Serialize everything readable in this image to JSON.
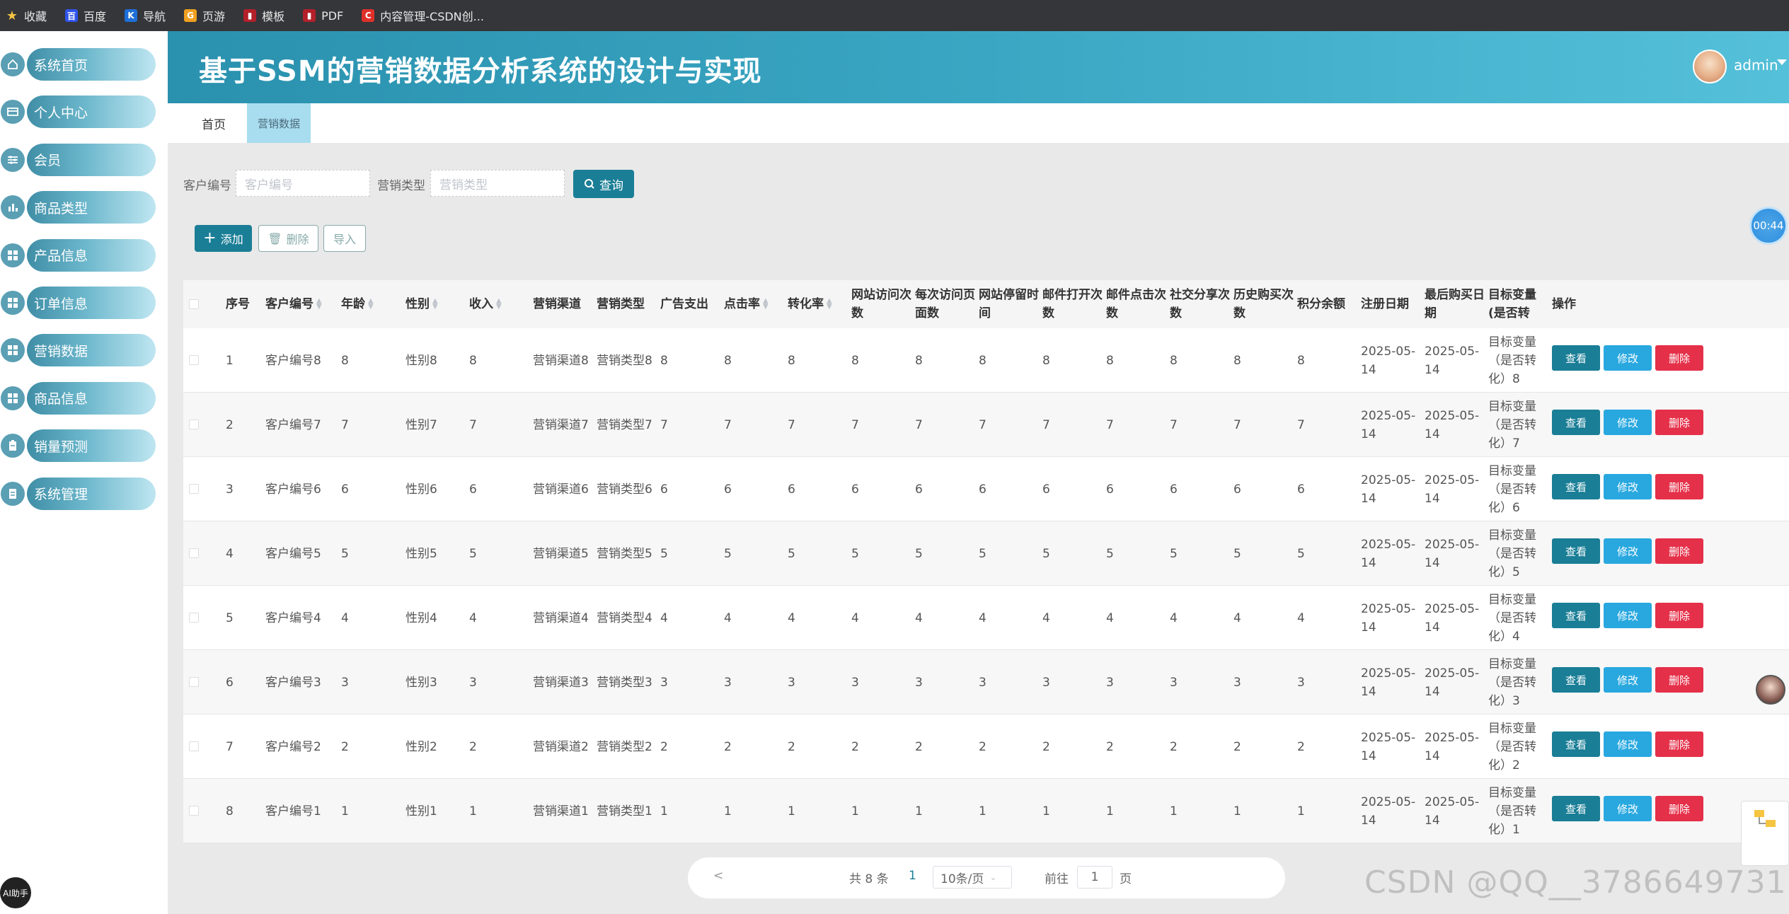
{
  "bookmarks": [
    {
      "label": "收藏",
      "color": "#f4c542",
      "glyph": "★"
    },
    {
      "label": "百度",
      "color": "#2f54eb",
      "glyph": "百"
    },
    {
      "label": "导航",
      "color": "#1e6fd9",
      "glyph": "K"
    },
    {
      "label": "页游",
      "color": "#f0a020",
      "glyph": "G"
    },
    {
      "label": "模板",
      "color": "#b3202a",
      "glyph": "▮"
    },
    {
      "label": "PDF",
      "color": "#b3202a",
      "glyph": "▮"
    },
    {
      "label": "内容管理-CSDN创...",
      "color": "#e0302a",
      "glyph": "C"
    }
  ],
  "app_title": "基于SSM的营销数据分析系统的设计与实现",
  "user": {
    "name": "admin"
  },
  "sidebar": [
    {
      "label": "系统首页",
      "icon": "home-icon"
    },
    {
      "label": "个人中心",
      "icon": "card-icon"
    },
    {
      "label": "会员",
      "icon": "sliders-icon"
    },
    {
      "label": "商品类型",
      "icon": "bar-chart-icon"
    },
    {
      "label": "产品信息",
      "icon": "grid-icon"
    },
    {
      "label": "订单信息",
      "icon": "grid-icon"
    },
    {
      "label": "营销数据",
      "icon": "grid-icon"
    },
    {
      "label": "商品信息",
      "icon": "grid-icon"
    },
    {
      "label": "销量预测",
      "icon": "clipboard-icon"
    },
    {
      "label": "系统管理",
      "icon": "document-icon"
    }
  ],
  "tabs": {
    "home": "首页",
    "current": "营销数据"
  },
  "search": {
    "customer_label": "客户编号",
    "customer_placeholder": "客户编号",
    "type_label": "营销类型",
    "type_placeholder": "营销类型",
    "button": "查询"
  },
  "actions": {
    "add": "添加",
    "delete": "删除",
    "import": "导入"
  },
  "table": {
    "headers": {
      "index": "序号",
      "customer_no": "客户编号",
      "age": "年龄",
      "gender": "性别",
      "income": "收入",
      "channel": "营销渠道",
      "mtype": "营销类型",
      "ad_spend": "广告支出",
      "ctr": "点击率",
      "conv": "转化率",
      "visits": "网站访问次数",
      "pages": "每次访问页面数",
      "stay": "网站停留时间",
      "open": "邮件打开次数",
      "click": "邮件点击次数",
      "share": "社交分享次数",
      "hist": "历史购买次数",
      "points": "积分余额",
      "reg": "注册日期",
      "last": "最后购买日期",
      "target": "目标变量(是否转化)",
      "ops": "操作"
    },
    "rows": [
      {
        "i": "1",
        "c": "客户编号8",
        "a": "8",
        "g": "性别8",
        "inc": "8",
        "ch": "营销渠道8",
        "mt": "营销类型8",
        "ad": "8",
        "ctr": "8",
        "cv": "8",
        "vs": "8",
        "pg": "8",
        "st": "8",
        "op": "8",
        "ck": "8",
        "sh": "8",
        "hi": "8",
        "pt": "8",
        "rg": "2025-05-14",
        "ls": "2025-05-14",
        "tg": "目标变量（是否转化）8"
      },
      {
        "i": "2",
        "c": "客户编号7",
        "a": "7",
        "g": "性别7",
        "inc": "7",
        "ch": "营销渠道7",
        "mt": "营销类型7",
        "ad": "7",
        "ctr": "7",
        "cv": "7",
        "vs": "7",
        "pg": "7",
        "st": "7",
        "op": "7",
        "ck": "7",
        "sh": "7",
        "hi": "7",
        "pt": "7",
        "rg": "2025-05-14",
        "ls": "2025-05-14",
        "tg": "目标变量（是否转化）7"
      },
      {
        "i": "3",
        "c": "客户编号6",
        "a": "6",
        "g": "性别6",
        "inc": "6",
        "ch": "营销渠道6",
        "mt": "营销类型6",
        "ad": "6",
        "ctr": "6",
        "cv": "6",
        "vs": "6",
        "pg": "6",
        "st": "6",
        "op": "6",
        "ck": "6",
        "sh": "6",
        "hi": "6",
        "pt": "6",
        "rg": "2025-05-14",
        "ls": "2025-05-14",
        "tg": "目标变量（是否转化）6"
      },
      {
        "i": "4",
        "c": "客户编号5",
        "a": "5",
        "g": "性别5",
        "inc": "5",
        "ch": "营销渠道5",
        "mt": "营销类型5",
        "ad": "5",
        "ctr": "5",
        "cv": "5",
        "vs": "5",
        "pg": "5",
        "st": "5",
        "op": "5",
        "ck": "5",
        "sh": "5",
        "hi": "5",
        "pt": "5",
        "rg": "2025-05-14",
        "ls": "2025-05-14",
        "tg": "目标变量（是否转化）5"
      },
      {
        "i": "5",
        "c": "客户编号4",
        "a": "4",
        "g": "性别4",
        "inc": "4",
        "ch": "营销渠道4",
        "mt": "营销类型4",
        "ad": "4",
        "ctr": "4",
        "cv": "4",
        "vs": "4",
        "pg": "4",
        "st": "4",
        "op": "4",
        "ck": "4",
        "sh": "4",
        "hi": "4",
        "pt": "4",
        "rg": "2025-05-14",
        "ls": "2025-05-14",
        "tg": "目标变量（是否转化）4"
      },
      {
        "i": "6",
        "c": "客户编号3",
        "a": "3",
        "g": "性别3",
        "inc": "3",
        "ch": "营销渠道3",
        "mt": "营销类型3",
        "ad": "3",
        "ctr": "3",
        "cv": "3",
        "vs": "3",
        "pg": "3",
        "st": "3",
        "op": "3",
        "ck": "3",
        "sh": "3",
        "hi": "3",
        "pt": "3",
        "rg": "2025-05-14",
        "ls": "2025-05-14",
        "tg": "目标变量（是否转化）3"
      },
      {
        "i": "7",
        "c": "客户编号2",
        "a": "2",
        "g": "性别2",
        "inc": "2",
        "ch": "营销渠道2",
        "mt": "营销类型2",
        "ad": "2",
        "ctr": "2",
        "cv": "2",
        "vs": "2",
        "pg": "2",
        "st": "2",
        "op": "2",
        "ck": "2",
        "sh": "2",
        "hi": "2",
        "pt": "2",
        "rg": "2025-05-14",
        "ls": "2025-05-14",
        "tg": "目标变量（是否转化）2"
      },
      {
        "i": "8",
        "c": "客户编号1",
        "a": "1",
        "g": "性别1",
        "inc": "1",
        "ch": "营销渠道1",
        "mt": "营销类型1",
        "ad": "1",
        "ctr": "1",
        "cv": "1",
        "vs": "1",
        "pg": "1",
        "st": "1",
        "op": "1",
        "ck": "1",
        "sh": "1",
        "hi": "1",
        "pt": "1",
        "rg": "2025-05-14",
        "ls": "2025-05-14",
        "tg": "目标变量（是否转化）1"
      }
    ],
    "row_buttons": {
      "view": "查看",
      "edit": "修改",
      "delete": "删除"
    }
  },
  "pagination": {
    "prev": "<",
    "total": "共 8 条",
    "current_page": "1",
    "page_size": "10条/页",
    "goto_label": "前往",
    "goto_value": "1",
    "page_unit": "页"
  },
  "timer": "00:44",
  "ai_assistant": "AI助手",
  "watermark": "CSDN @QQ__3786649731"
}
